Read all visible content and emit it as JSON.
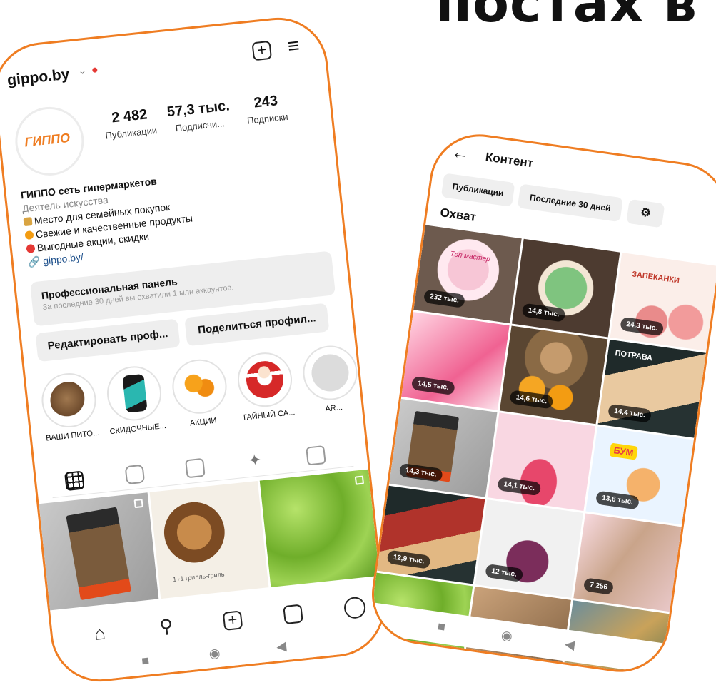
{
  "heading": "постах в",
  "profile": {
    "username": "gippo.by",
    "avatar_text": "ГИППО",
    "stats": [
      {
        "value": "2 482",
        "label": "Публикации"
      },
      {
        "value": "57,3 тыс.",
        "label": "Подписчи..."
      },
      {
        "value": "243",
        "label": "Подписки"
      }
    ],
    "bio": {
      "name": "ГИППО сеть гипермаркетов",
      "category": "Деятель искусства",
      "lines": [
        "Место для семейных покупок",
        "Свежие и качественные продукты",
        "Выгодные акции, скидки"
      ],
      "link": "gippo.by/"
    },
    "pro_panel": {
      "title": "Профессиональная панель",
      "subtitle": "За последние 30 дней вы охватили 1 млн аккаунтов."
    },
    "buttons": {
      "edit": "Редактировать проф...",
      "share": "Поделиться профил..."
    },
    "highlights": [
      "ВАШИ ПИТО...",
      "СКИДОЧНЫЕ...",
      "АКЦИИ",
      "ТАЙНЫЙ СА...",
      "AR..."
    ],
    "post_overlay": "1+1 грилль-гриль"
  },
  "content": {
    "title": "Контент",
    "chips": [
      "Публикации",
      "Последние 30 дней"
    ],
    "reach_label": "Охват",
    "views": [
      "232 тыс.",
      "14,8 тыс.",
      "24,3 тыс.",
      "14,5 тыс.",
      "14,6 тыс.",
      "14,4 тыс.",
      "14,3 тыс.",
      "14,1 тыс.",
      "13,6 тыс.",
      "12,9 тыс.",
      "12 тыс.",
      "7 256"
    ],
    "card_text": [
      "Топ мастер",
      "ЗАПЕКАНКИ",
      "ПОТРАВА",
      "БУМ"
    ]
  },
  "colors": {
    "accent": "#ef7d22",
    "link": "#1b4e8a",
    "panel": "#eeeeee"
  }
}
